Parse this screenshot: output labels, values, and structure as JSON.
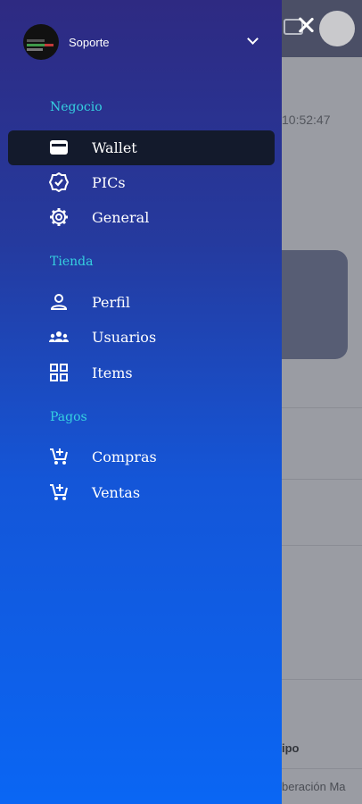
{
  "background": {
    "time_text": "10:52:47",
    "equipo_text": "ipo",
    "liberacion_text": "beración Ma"
  },
  "account": {
    "name": "Soporte"
  },
  "sections": [
    {
      "title": "Negocio",
      "items": [
        {
          "label": "Wallet",
          "icon": "wallet-icon",
          "active": true
        },
        {
          "label": "PICs",
          "icon": "check-badge-icon",
          "active": false
        },
        {
          "label": "General",
          "icon": "gear-icon",
          "active": false
        }
      ]
    },
    {
      "title": "Tienda",
      "items": [
        {
          "label": "Perfil",
          "icon": "person-icon",
          "active": false
        },
        {
          "label": "Usuarios",
          "icon": "group-icon",
          "active": false
        },
        {
          "label": "Items",
          "icon": "grid-icon",
          "active": false
        }
      ]
    },
    {
      "title": "Pagos",
      "items": [
        {
          "label": "Compras",
          "icon": "cart-add-icon",
          "active": false
        },
        {
          "label": "Ventas",
          "icon": "cart-add-icon",
          "active": false
        }
      ]
    }
  ],
  "colors": {
    "section_title": "#35d1e0",
    "active_bg": "#131a2c"
  }
}
